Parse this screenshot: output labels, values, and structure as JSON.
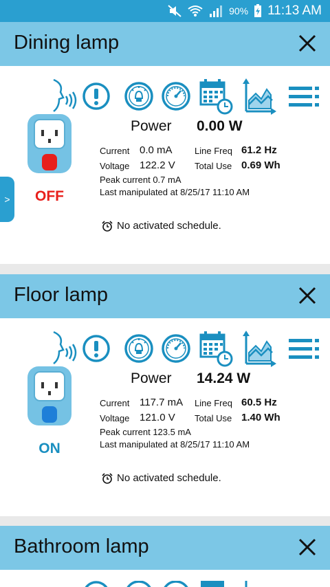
{
  "status_bar": {
    "battery": "90%",
    "time": "11:13 AM",
    "icons": [
      "mute-icon",
      "wifi-icon",
      "signal-icon",
      "battery-charging-icon"
    ]
  },
  "devices": [
    {
      "name": "Dining lamp",
      "state": "OFF",
      "power_label": "Power",
      "power_value": "0.00 W",
      "current_label": "Current",
      "current_value": "0.0 mA",
      "line_freq_label": "Line Freq",
      "line_freq_value": "61.2 Hz",
      "voltage_label": "Voltage",
      "voltage_value": "122.2 V",
      "total_use_label": "Total Use",
      "total_use_value": "0.69 Wh",
      "peak_current": "Peak current  0.7 mA",
      "last_manipulated": "Last manipulated at  8/25/17 11:10 AM",
      "schedule": "No activated schedule."
    },
    {
      "name": "Floor lamp",
      "state": "ON",
      "power_label": "Power",
      "power_value": "14.24 W",
      "current_label": "Current",
      "current_value": "117.7 mA",
      "line_freq_label": "Line Freq",
      "line_freq_value": "60.5 Hz",
      "voltage_label": "Voltage",
      "voltage_value": "121.0 V",
      "total_use_label": "Total Use",
      "total_use_value": "1.40 Wh",
      "peak_current": "Peak current  123.5 mA",
      "last_manipulated": "Last manipulated at  8/25/17 11:10 AM",
      "schedule": "No activated schedule."
    },
    {
      "name": "Bathroom lamp"
    }
  ],
  "side_tab": {
    "label": ">"
  },
  "colors": {
    "status_bar": "#2a9fd0",
    "header": "#7cc7e6",
    "icon_blue": "#1a8fc0",
    "off_red": "#e8201c",
    "on_blue": "#1a8fc0",
    "plug_body": "#75c2e4"
  }
}
